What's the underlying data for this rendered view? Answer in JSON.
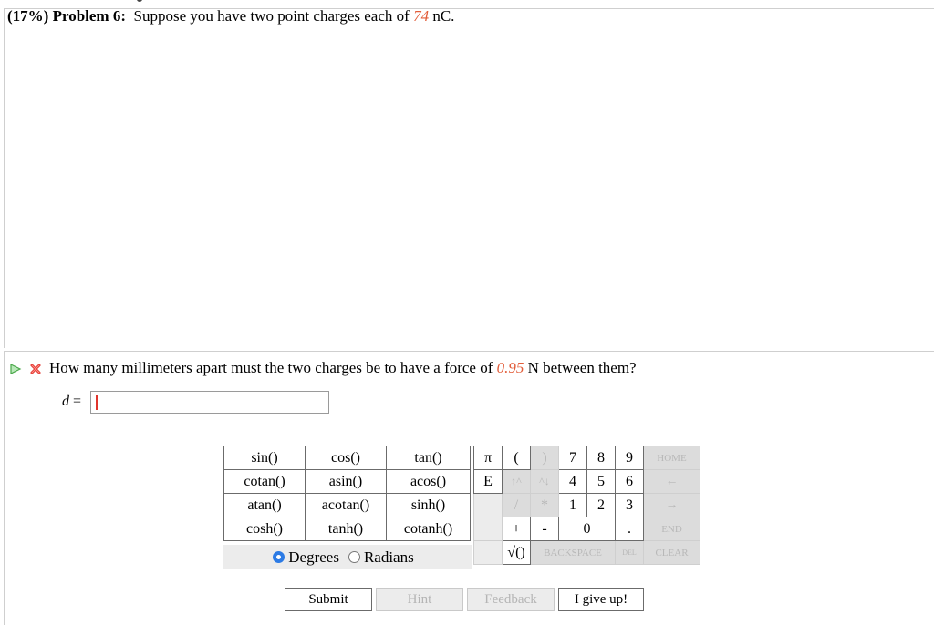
{
  "problem": {
    "percent": "(17%)",
    "label": "Problem 6:",
    "text_before": "Suppose you have two point charges each of",
    "charge_value": "74",
    "text_after": "nC."
  },
  "question": {
    "text_before": "How many millimeters apart must the two charges be to have a force of",
    "force_value": "0.95",
    "text_after": "N between them?",
    "answer_label": "d",
    "answer_eq": "=",
    "answer_value": ""
  },
  "functions": [
    [
      "sin()",
      "cos()",
      "tan()"
    ],
    [
      "cotan()",
      "asin()",
      "acos()"
    ],
    [
      "atan()",
      "acotan()",
      "sinh()"
    ],
    [
      "cosh()",
      "tanh()",
      "cotanh()"
    ]
  ],
  "angle_mode": {
    "degrees": "Degrees",
    "radians": "Radians",
    "selected": "Degrees"
  },
  "keypad": {
    "pi": "π",
    "e": "E",
    "open_paren": "(",
    "close_paren": ")",
    "up_arrow": "↑^",
    "down_arrow": "^↓",
    "divide": "/",
    "multiply": "*",
    "plus": "+",
    "minus": "-",
    "sqrt": "√()",
    "digits": {
      "7": "7",
      "8": "8",
      "9": "9",
      "4": "4",
      "5": "5",
      "6": "6",
      "1": "1",
      "2": "2",
      "3": "3",
      "0": "0"
    },
    "dot": ".",
    "home": "HOME",
    "left": "←",
    "right": "→",
    "end": "END",
    "backspace": "BACKSPACE",
    "del": "DEL",
    "clear": "CLEAR"
  },
  "buttons": {
    "submit": "Submit",
    "hint": "Hint",
    "feedback": "Feedback",
    "give_up": "I give up!"
  },
  "colors": {
    "accent_red": "#e25d3a",
    "radio_blue": "#2c7be5",
    "play_green": "#7ccf7c",
    "x_red": "#e0342c"
  }
}
